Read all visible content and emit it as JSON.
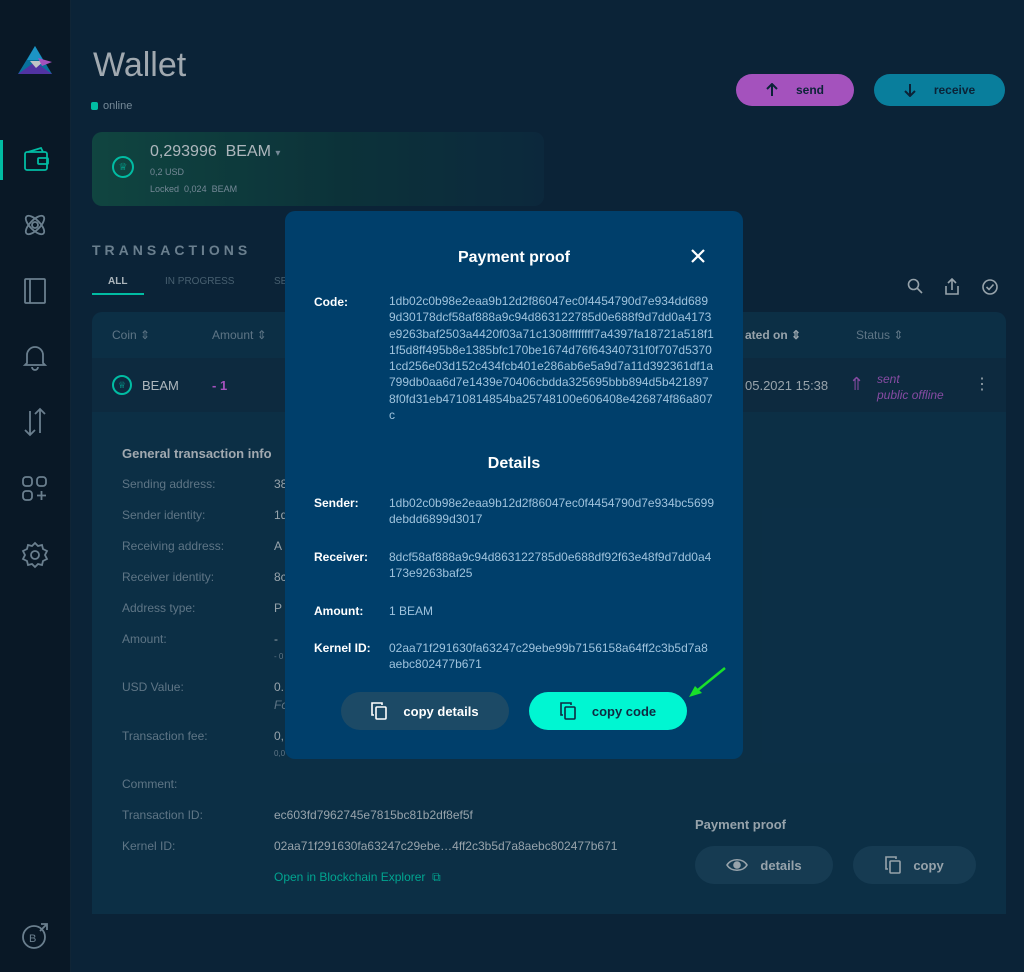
{
  "sidebar": {
    "items": [
      {
        "icon": "wallet-icon"
      },
      {
        "icon": "atom-icon"
      },
      {
        "icon": "address-book-icon"
      },
      {
        "icon": "bell-icon"
      },
      {
        "icon": "swap-icon"
      },
      {
        "icon": "apps-icon"
      },
      {
        "icon": "settings-icon"
      }
    ],
    "bottom_icon": "beamx-icon"
  },
  "header": {
    "title": "Wallet",
    "status": "online",
    "send_label": "send",
    "receive_label": "receive"
  },
  "balance": {
    "amount": "0,293996",
    "currency": "BEAM",
    "usd": "0,2 USD",
    "locked_label": "Locked",
    "locked_value": "0,024",
    "locked_currency": "BEAM"
  },
  "transactions": {
    "heading": "TRANSACTIONS",
    "tabs": [
      "ALL",
      "IN PROGRESS",
      "SE"
    ],
    "columns": {
      "coin": "Coin",
      "amount": "Amount",
      "created": "ated on",
      "status": "Status"
    },
    "row": {
      "coin": "BEAM",
      "amount": "- 1",
      "date": "05.2021 15:38",
      "status_line1": "sent",
      "status_line2": "public offline"
    }
  },
  "info": {
    "title": "General transaction info",
    "labels": {
      "sending_address": "Sending address:",
      "sender_identity": "Sender identity:",
      "receiving_address": "Receiving address:",
      "receiver_identity": "Receiver identity:",
      "address_type": "Address type:",
      "amount": "Amount:",
      "usd_value": "USD Value:",
      "tx_fee": "Transaction fee:",
      "comment": "Comment:",
      "tx_id": "Transaction ID:",
      "kernel_id": "Kernel ID:"
    },
    "values": {
      "sending_address": "38",
      "sender_identity": "1d",
      "receiving_address": "A",
      "receiver_identity": "8c",
      "address_type": "P",
      "amount": "-",
      "amount_sub": "- 0",
      "usd_value": "0.",
      "usd_sub": "Fo",
      "tx_fee": "0,",
      "tx_fee_sub": "0,0",
      "tx_id": "ec603fd7962745e7815bc81b2df8ef5f",
      "kernel_id": "02aa71f291630fa63247c29ebe…4ff2c3b5d7a8aebc802477b671",
      "explorer_link": "Open in Blockchain Explorer"
    },
    "payment_proof": {
      "label": "Payment proof",
      "details_btn": "details",
      "copy_btn": "copy"
    }
  },
  "modal": {
    "title": "Payment proof",
    "code_label": "Code:",
    "code_value": "1db02c0b98e2eaa9b12d2f86047ec0f4454790d7e934dd6899d30178dcf58af888a9c94d863122785d0e688f9d7dd0a4173e9263baf2503a4420f03a71c1308ffffffff7a4397fa18721a518f11f5d8ff495b8e1385bfc170be1674d76f64340731f0f707d53701cd256e03d152c434fcb401e286ab6e5a9d7a11d392361df1a799db0aa6d7e1439e70406cbdda325695bbb894d5b4218978f0fd31eb4710814854ba25748100e606408e426874f86a807c",
    "details_heading": "Details",
    "sender_label": "Sender:",
    "sender_value": "1db02c0b98e2eaa9b12d2f86047ec0f4454790d7e934bc5699debdd6899d3017",
    "receiver_label": "Receiver:",
    "receiver_value": "8dcf58af888a9c94d863122785d0e688df92f63e48f9d7dd0a4173e9263baf25",
    "amount_label": "Amount:",
    "amount_value": "1 BEAM",
    "kernel_label": "Kernel ID:",
    "kernel_value": "02aa71f291630fa63247c29ebe99b7156158a64ff2c3b5d7a8aebc802477b671",
    "copy_details_label": "copy details",
    "copy_code_label": "copy code"
  },
  "colors": {
    "accent": "#00f6d2",
    "send": "#da68f5",
    "receive": "#0bccf7",
    "modal_bg": "#003f6b",
    "sent_status": "#b25fd1"
  }
}
